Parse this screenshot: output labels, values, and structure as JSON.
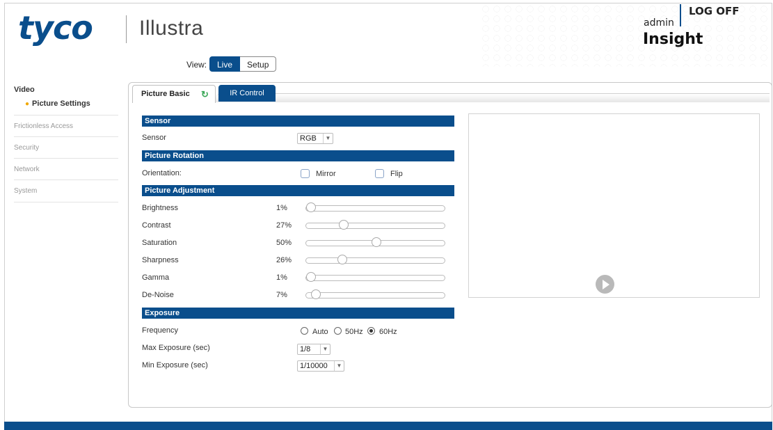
{
  "header": {
    "brand": "tyco",
    "product": "Illustra",
    "logoff": "LOG OFF",
    "user": "admin",
    "insight": "Insight",
    "brand_color": "#0a4e8c"
  },
  "view": {
    "label": "View:",
    "live": "Live",
    "setup": "Setup"
  },
  "sidebar": {
    "section": "Video",
    "active_item": "Picture Settings",
    "items": [
      "Frictionless Access",
      "Security",
      "Network",
      "System"
    ]
  },
  "tabs": {
    "picture_basic": "Picture Basic",
    "ir_control": "IR Control",
    "refresh_icon": "refresh-icon"
  },
  "sensor": {
    "title": "Sensor",
    "label": "Sensor",
    "value": "RGB"
  },
  "rotation": {
    "title": "Picture Rotation",
    "label": "Orientation:",
    "mirror": "Mirror",
    "flip": "Flip",
    "mirror_checked": false,
    "flip_checked": false
  },
  "adjustment": {
    "title": "Picture Adjustment",
    "sliders": [
      {
        "label": "Brightness",
        "pct": "1%",
        "value": 1
      },
      {
        "label": "Contrast",
        "pct": "27%",
        "value": 27
      },
      {
        "label": "Saturation",
        "pct": "50%",
        "value": 50
      },
      {
        "label": "Sharpness",
        "pct": "26%",
        "value": 26
      },
      {
        "label": "Gamma",
        "pct": "1%",
        "value": 1
      },
      {
        "label": "De-Noise",
        "pct": "7%",
        "value": 7
      }
    ]
  },
  "exposure": {
    "title": "Exposure",
    "frequency_label": "Frequency",
    "auto": "Auto",
    "hz50": "50Hz",
    "hz60": "60Hz",
    "selected": "60Hz",
    "max_label": "Max Exposure (sec)",
    "max_value": "1/8",
    "min_label": "Min Exposure (sec)",
    "min_value": "1/10000"
  }
}
